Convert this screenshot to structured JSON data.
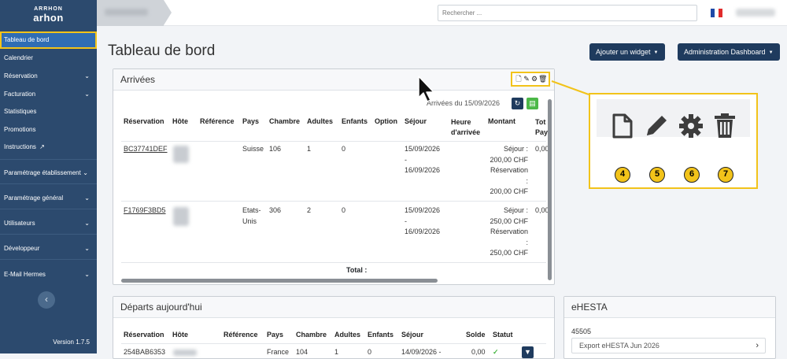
{
  "sidebar": {
    "logo_top": "ARRHON",
    "logo_main": "arhon",
    "items": [
      {
        "label": "Tableau de bord"
      },
      {
        "label": "Calendrier"
      },
      {
        "label": "Réservation"
      },
      {
        "label": "Facturation"
      },
      {
        "label": "Statistiques"
      },
      {
        "label": "Promotions"
      },
      {
        "label": "Instructions"
      },
      {
        "label": "Paramétrage établissement"
      },
      {
        "label": "Paramétrage général"
      },
      {
        "label": "Utilisateurs"
      },
      {
        "label": "Développeur"
      },
      {
        "label": "E-Mail Hermes"
      }
    ],
    "collapse_glyph": "‹",
    "version": "Version 1.7.5"
  },
  "topbar": {
    "search_placeholder": "Rechercher ...",
    "flag_colors": [
      "#1f4aa8",
      "#ffffff",
      "#e12b2b"
    ]
  },
  "main": {
    "title": "Tableau de bord",
    "add_widget_label": "Ajouter un widget",
    "admin_dashboard_label": "Administration Dashboard"
  },
  "arrivals": {
    "title": "Arrivées",
    "date_label": "Arrivées du 15/09/2026",
    "columns": [
      "Réservation",
      "Hôte",
      "Référence",
      "Pays",
      "Chambre",
      "Adultes",
      "Enfants",
      "Option",
      "Séjour",
      "Heure d'arrivée",
      "Montant",
      "Tot Pay"
    ],
    "rows": [
      {
        "reservation": "BC37741DEF",
        "pays": "Suisse",
        "chambre": "106",
        "adultes": "1",
        "enfants": "0",
        "sejour": [
          "15/09/2026",
          "-",
          "16/09/2026"
        ],
        "montant": [
          "Séjour :",
          "200,00 CHF",
          "Réservation",
          ":",
          "200,00 CHF"
        ],
        "total": "0,00"
      },
      {
        "reservation": "F1769F3BD5",
        "pays": "Etats-Unis",
        "chambre": "306",
        "adultes": "2",
        "enfants": "0",
        "sejour": [
          "15/09/2026",
          "-",
          "16/09/2026"
        ],
        "montant": [
          "Séjour :",
          "250,00 CHF",
          "Réservation",
          ":",
          "250,00 CHF"
        ],
        "total": "0,00"
      }
    ],
    "total_label": "Total :"
  },
  "departures": {
    "title": "Départs aujourd'hui",
    "columns": [
      "Réservation",
      "Hôte",
      "Référence",
      "Pays",
      "Chambre",
      "Adultes",
      "Enfants",
      "Séjour",
      "Solde",
      "Statut"
    ],
    "row": {
      "reservation": "254BAB6353",
      "pays": "France",
      "chambre": "104",
      "adultes": "1",
      "enfants": "0",
      "sejour": "14/09/2026 -",
      "solde": "0,00",
      "statut": "✓"
    }
  },
  "ehesta": {
    "title": "eHESTA",
    "number": "45505",
    "export_label": "Export eHESTA Jun 2026"
  },
  "callout": {
    "badges": [
      "4",
      "5",
      "6",
      "7"
    ],
    "icons": [
      "new-document-icon",
      "edit-pencil-icon",
      "settings-gear-icon",
      "trash-icon"
    ]
  }
}
